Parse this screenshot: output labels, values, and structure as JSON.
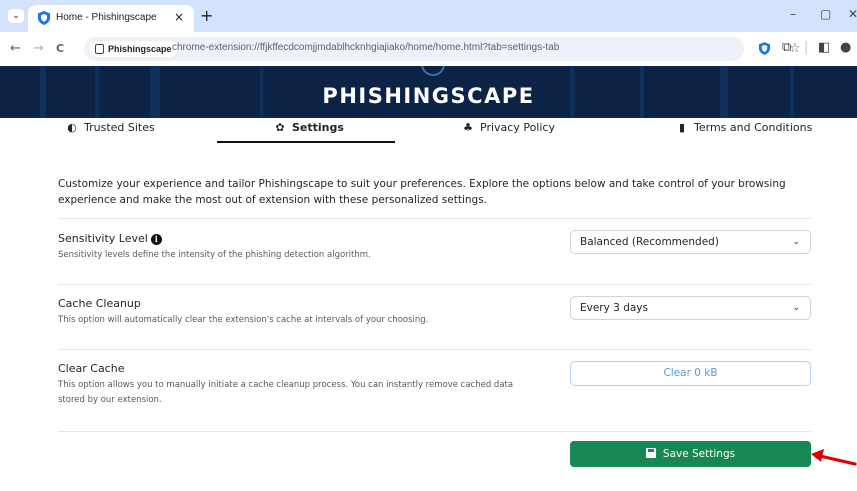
{
  "browser": {
    "tab": {
      "title": "Home - Phishingscape",
      "favicon": "shield-favicon-icon",
      "close_glyph": "×"
    },
    "new_tab_glyph": "+",
    "tab_menu_glyph": "⌄",
    "window_controls": {
      "minimize": "–",
      "maximize": "▢",
      "close": "✕"
    },
    "nav": {
      "back": "←",
      "forward": "→",
      "reload": "C"
    },
    "site_chip": "Phishingscape",
    "url": "chrome-extension://ffjkffecdcomjjmdablhcknhgiajiako/home/home.html?tab=settings-tab",
    "toolbar_icons": [
      "star-icon",
      "extension-shield-icon",
      "puzzle-icon",
      "side-panel-icon",
      "profile-icon"
    ],
    "toolbar_glyphs": {
      "star": "☆",
      "puzzle": "⧉",
      "sep": "|",
      "panel": "◧",
      "profile": "●"
    }
  },
  "banner": {
    "title": "PHISHINGSCAPE"
  },
  "nav_tabs": [
    {
      "label": "Trusted Sites",
      "icon": "◐",
      "active": false
    },
    {
      "label": "Settings",
      "icon": "✿",
      "active": true
    },
    {
      "label": "Privacy Policy",
      "icon": "♣",
      "active": false
    },
    {
      "label": "Terms and Conditions",
      "icon": "▮",
      "active": false
    }
  ],
  "intro": "Customize your experience and tailor Phishingscape to suit your preferences. Explore the options below and take control of your browsing experience and make the most out of extension with these personalized settings.",
  "settings": {
    "sensitivity": {
      "title": "Sensitivity Level",
      "info_glyph": "i",
      "description": "Sensitivity levels define the intensity of the phishing detection algorithm.",
      "selected": "Balanced (Recommended)"
    },
    "cache_cleanup": {
      "title": "Cache Cleanup",
      "description": "This option will automatically clear the extension's cache at intervals of your choosing.",
      "selected": "Every 3 days"
    },
    "clear_cache": {
      "title": "Clear Cache",
      "description": "This option allows you to manually initiate a cache cleanup process. You can instantly remove cached data stored by our extension.",
      "button": "Clear 0 kB"
    }
  },
  "save_button": "Save Settings",
  "chevron_glyph": "⌄",
  "colors": {
    "banner": "#0c2346",
    "save": "#198754",
    "clear_text": "#5b9bd5",
    "annotation_arrow": "#e00000"
  }
}
